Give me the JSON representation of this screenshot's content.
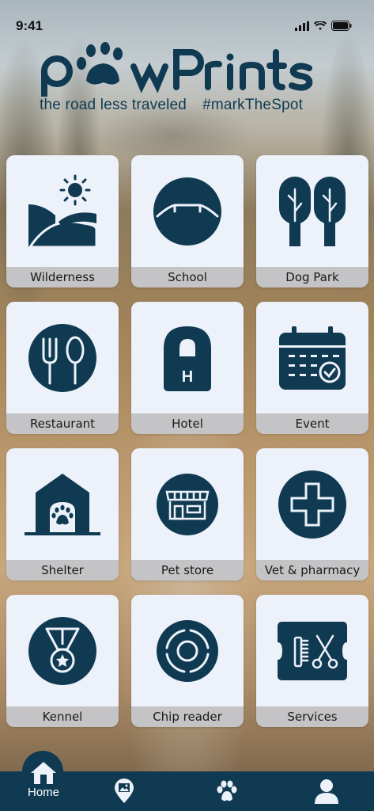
{
  "status_bar": {
    "time": "9:41"
  },
  "app": {
    "tagline_left": "the road less traveled",
    "tagline_right": "#markTheSpot"
  },
  "colors": {
    "primary": "#0f3a52",
    "tile_bg": "#edf1f9"
  },
  "tiles": [
    {
      "label": "Wilderness",
      "icon": "wilderness-icon"
    },
    {
      "label": "School",
      "icon": "school-icon"
    },
    {
      "label": "Dog Park",
      "icon": "dog-park-icon"
    },
    {
      "label": "Restaurant",
      "icon": "restaurant-icon"
    },
    {
      "label": "Hotel",
      "icon": "hotel-icon"
    },
    {
      "label": "Event",
      "icon": "event-calendar-icon"
    },
    {
      "label": "Shelter",
      "icon": "shelter-icon"
    },
    {
      "label": "Pet store",
      "icon": "pet-store-icon"
    },
    {
      "label": "Vet & pharmacy",
      "icon": "vet-cross-icon"
    },
    {
      "label": "Kennel",
      "icon": "kennel-medal-icon"
    },
    {
      "label": "Chip reader",
      "icon": "chip-reader-icon"
    },
    {
      "label": "Services",
      "icon": "services-icon"
    }
  ],
  "tabbar": {
    "home_label": "Home",
    "items": [
      "home-icon",
      "map-pin-icon",
      "paw-icon",
      "profile-icon"
    ]
  }
}
